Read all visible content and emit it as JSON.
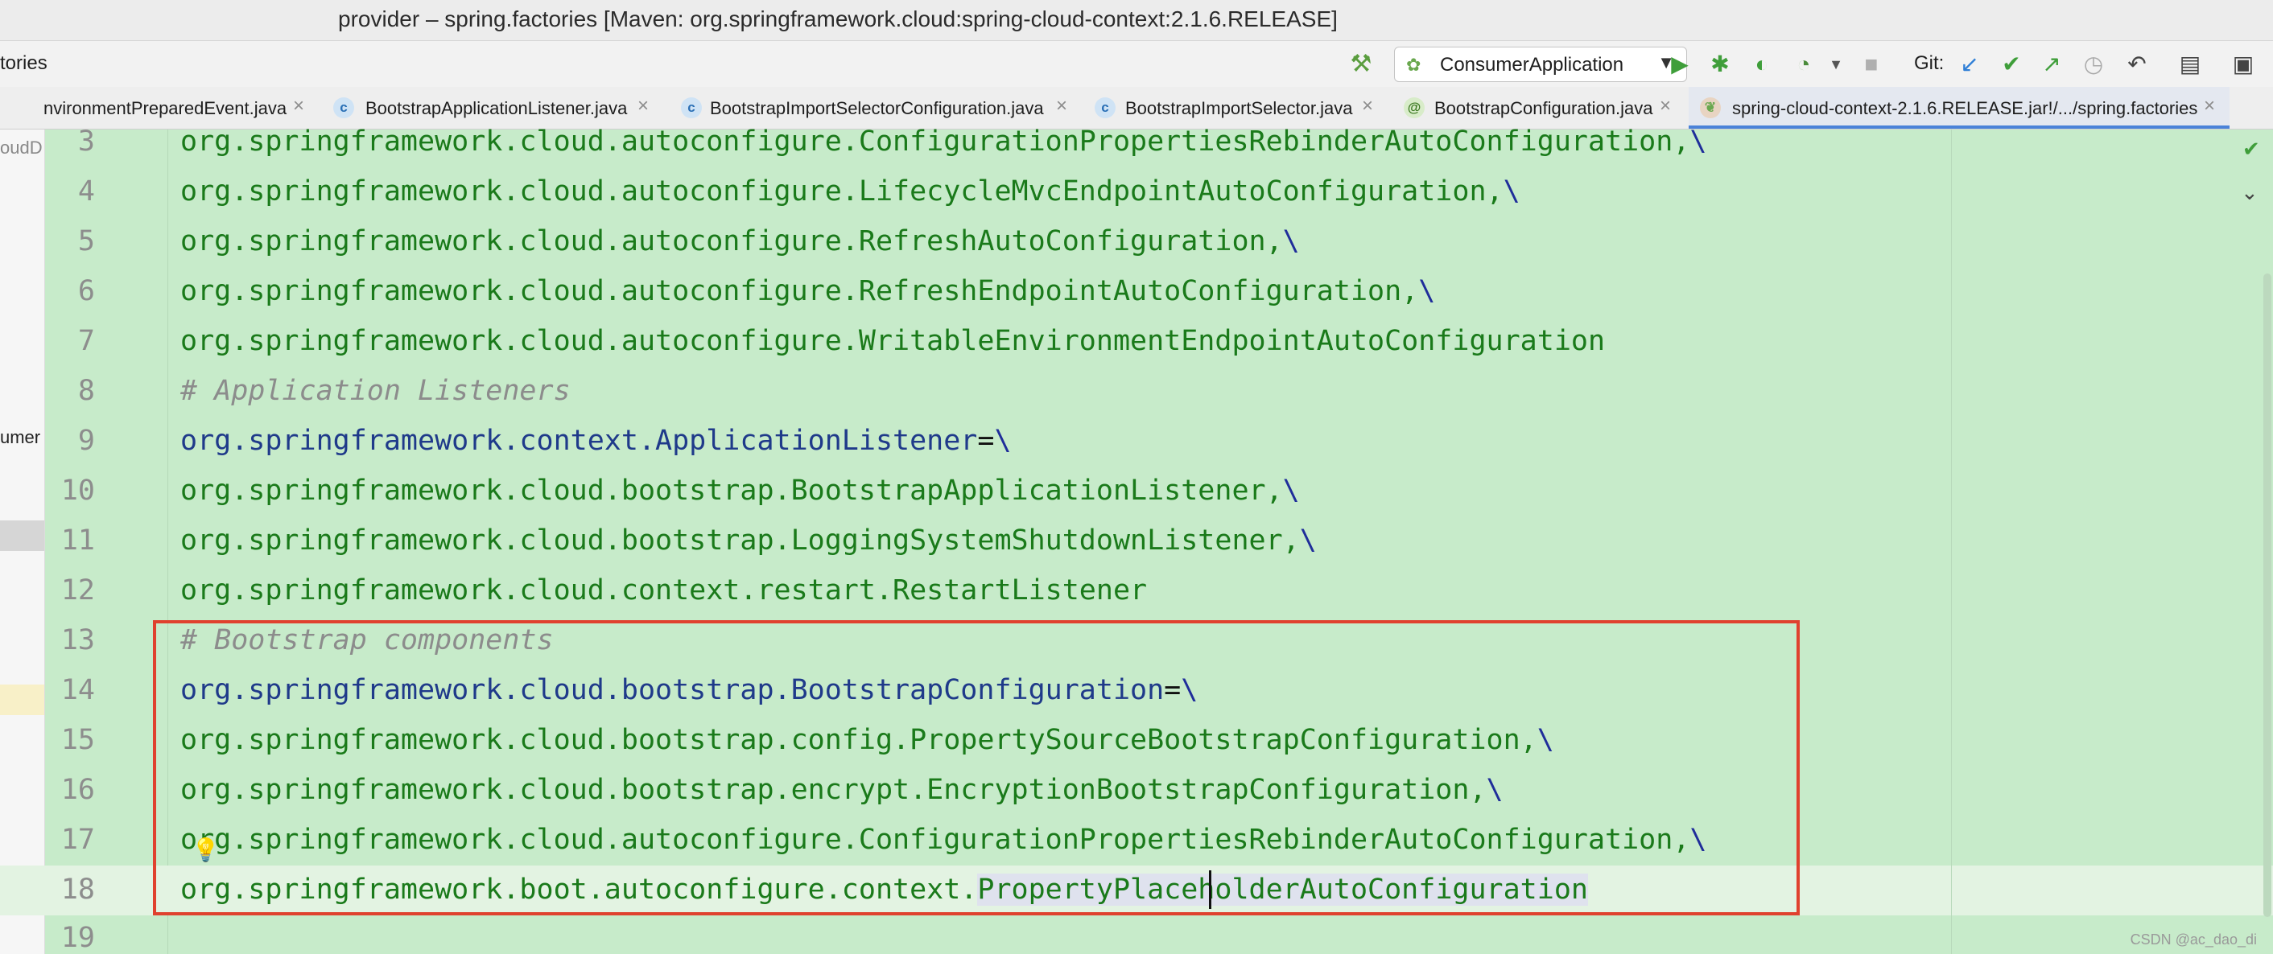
{
  "window": {
    "title": "provider – spring.factories [Maven: org.springframework.cloud:spring-cloud-context:2.1.6.RELEASE]"
  },
  "toolbar": {
    "breadcrumb": "tories",
    "run_config": "ConsumerApplication",
    "git_label": "Git:"
  },
  "tabs": [
    {
      "label": "nvironmentPreparedEvent.java",
      "icon": ""
    },
    {
      "label": "BootstrapApplicationListener.java",
      "icon": "c"
    },
    {
      "label": "BootstrapImportSelectorConfiguration.java",
      "icon": "c"
    },
    {
      "label": "BootstrapImportSelector.java",
      "icon": "c"
    },
    {
      "label": "BootstrapConfiguration.java",
      "icon": "@"
    },
    {
      "label": "spring-cloud-context-2.1.6.RELEASE.jar!/.../spring.factories",
      "icon": "spring-icon"
    }
  ],
  "left_panel": {
    "frag1": "oudD",
    "frag2": "umer"
  },
  "editor": {
    "lines": [
      {
        "n": "3",
        "text": "org.springframework.cloud.autoconfigure.ConfigurationPropertiesRebinderAutoConfiguration,",
        "tail": "\\"
      },
      {
        "n": "4",
        "text": "org.springframework.cloud.autoconfigure.LifecycleMvcEndpointAutoConfiguration,",
        "tail": "\\"
      },
      {
        "n": "5",
        "text": "org.springframework.cloud.autoconfigure.RefreshAutoConfiguration,",
        "tail": "\\"
      },
      {
        "n": "6",
        "text": "org.springframework.cloud.autoconfigure.RefreshEndpointAutoConfiguration,",
        "tail": "\\"
      },
      {
        "n": "7",
        "text": "org.springframework.cloud.autoconfigure.WritableEnvironmentEndpointAutoConfiguration",
        "tail": ""
      },
      {
        "n": "8",
        "comment": "# Application Listeners"
      },
      {
        "n": "9",
        "key": "org.springframework.context.ApplicationListener",
        "eq": "=",
        "tail": "\\"
      },
      {
        "n": "10",
        "text": "org.springframework.cloud.bootstrap.BootstrapApplicationListener,",
        "tail": "\\"
      },
      {
        "n": "11",
        "text": "org.springframework.cloud.bootstrap.LoggingSystemShutdownListener,",
        "tail": "\\"
      },
      {
        "n": "12",
        "text": "org.springframework.cloud.context.restart.RestartListener",
        "tail": ""
      },
      {
        "n": "13",
        "comment": "# Bootstrap components"
      },
      {
        "n": "14",
        "key": "org.springframework.cloud.bootstrap.BootstrapConfiguration",
        "eq": "=",
        "tail": "\\"
      },
      {
        "n": "15",
        "text": "org.springframework.cloud.bootstrap.config.PropertySourceBootstrapConfiguration,",
        "tail": "\\"
      },
      {
        "n": "16",
        "text": "org.springframework.cloud.bootstrap.encrypt.EncryptionBootstrapConfiguration,",
        "tail": "\\"
      },
      {
        "n": "17",
        "text": "org.springframework.cloud.autoconfigure.ConfigurationPropertiesRebinderAutoConfiguration,",
        "tail": "\\"
      },
      {
        "n": "18",
        "pre": "org.springframework.boot.autoconfigure.context.",
        "selected": "PropertyPlaceholderAutoConfiguration"
      },
      {
        "n": "19"
      }
    ]
  },
  "watermark": "CSDN @ac_dao_di",
  "colors": {
    "editor_bg": "#c7ebca",
    "highlight_box": "#e0412e",
    "active_tab_underline": "#4a82d8"
  }
}
